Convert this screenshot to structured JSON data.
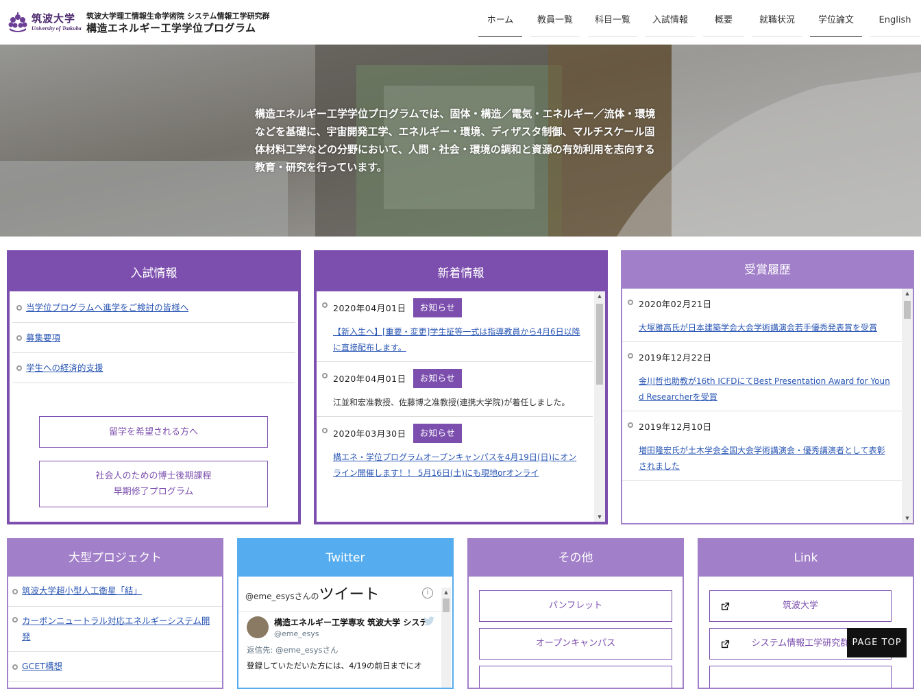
{
  "header": {
    "logo_jp": "筑波大学",
    "logo_en": "University of Tsukuba",
    "subtitle": "筑波大学理工情報生命学術院 システム情報工学研究群",
    "title": "構造エネルギー工学学位プログラム"
  },
  "nav": {
    "items": [
      {
        "label": "ホーム"
      },
      {
        "label": "教員一覧"
      },
      {
        "label": "科目一覧"
      },
      {
        "label": "入試情報"
      },
      {
        "label": "概要"
      },
      {
        "label": "就職状況"
      },
      {
        "label": "学位論文"
      },
      {
        "label": "English"
      }
    ]
  },
  "hero": {
    "text": "構造エネルギー工学学位プログラムでは、固体・構造／電気・エネルギー／流体・環境などを基礎に、宇宙開発工学、エネルギー・環境、ディザスタ制御、マルチスケール固体材料工学などの分野において、人間・社会・環境の調和と資源の有効利用を志向する教育・研究を行っています。"
  },
  "admission": {
    "title": "入試情報",
    "links": [
      {
        "label": "当学位プログラムへ進学をご検討の皆様へ"
      },
      {
        "label": "募集要項"
      },
      {
        "label": "学生への経済的支援"
      }
    ],
    "btn_study_abroad": "留学を希望される方へ",
    "btn_phd_line1": "社会人のための博士後期課程",
    "btn_phd_line2": "早期修了プログラム"
  },
  "news": {
    "title": "新着情報",
    "entries": [
      {
        "date": "2020年04月01日",
        "tag": "お知らせ",
        "body": "【新入生へ】[重要・変更]学生証等一式は指導教員から4月6日以降に直接配布します。"
      },
      {
        "date": "2020年04月01日",
        "tag": "お知らせ",
        "body": "江並和宏准教授、佐藤博之准教授(連携大学院)が着任しました。"
      },
      {
        "date": "2020年03月30日",
        "tag": "お知らせ",
        "body": "構エネ・学位プログラムオープンキャンパスを4月19日(日)にオンライン開催します！！ 5月16日(土)にも現地orオンライ"
      }
    ]
  },
  "awards": {
    "title": "受賞履歴",
    "entries": [
      {
        "date": "2020年02月21日",
        "body": "大塚雅高氏が日本建築学会大会学術講演会若手優秀発表賞を受賞"
      },
      {
        "date": "2019年12月22日",
        "body": "金川哲也助教が16th ICFDにてBest Presentation Award for Yound Researcherを受賞"
      },
      {
        "date": "2019年12月10日",
        "body": "増田隆宏氏が土木学会全国大会学術講演会・優秀講演者として表彰されました"
      }
    ]
  },
  "projects": {
    "title": "大型プロジェクト",
    "links": [
      {
        "label": "筑波大学超小型人工衛星「結」"
      },
      {
        "label": "カーボンニュートラル対応エネルギーシステム開発"
      },
      {
        "label": "GCET構想"
      }
    ]
  },
  "twitter": {
    "title": "Twitter",
    "handle_prefix": "@eme_esysさんの",
    "handle_suffix": "ツイート",
    "account_name": "構造エネルギー工学専攻 筑波大学 システ",
    "account_handle": "@eme_esys",
    "reply_to": "返信先: @eme_esysさん",
    "tweet_text": "登録していただいた方には、4/19の前日までにオ"
  },
  "others": {
    "title": "その他",
    "buttons": [
      {
        "label": "パンフレット"
      },
      {
        "label": "オープンキャンパス"
      }
    ]
  },
  "links": {
    "title": "Link",
    "buttons": [
      {
        "label": "筑波大学"
      },
      {
        "label": "システム情報工学研究群"
      }
    ]
  },
  "page_top": "PAGE TOP",
  "colors": {
    "purple": "#7c4fae",
    "light_purple": "#a27fc9",
    "twitter_blue": "#55acee",
    "link_blue": "#2b57b4"
  }
}
